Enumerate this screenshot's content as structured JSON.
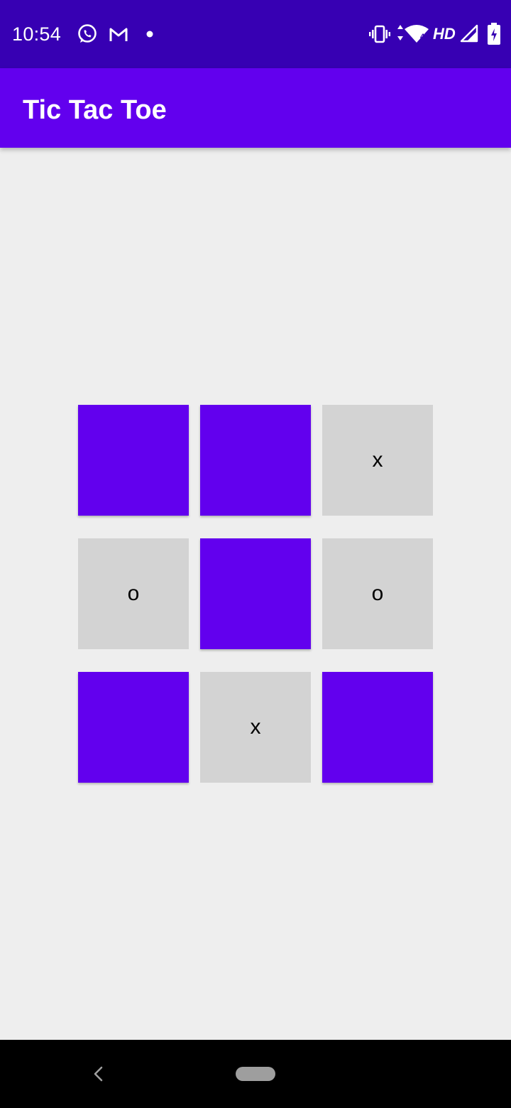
{
  "status_bar": {
    "time": "10:54",
    "icons": [
      "whatsapp-icon",
      "gmail-icon",
      "notification-dot-icon",
      "vibrate-icon",
      "wifi-icon",
      "signal-icon",
      "battery-charging-icon"
    ],
    "network_label": "HD"
  },
  "app_bar": {
    "title": "Tic Tac Toe"
  },
  "board": {
    "cells": [
      {
        "mark": ""
      },
      {
        "mark": ""
      },
      {
        "mark": "x"
      },
      {
        "mark": "o"
      },
      {
        "mark": ""
      },
      {
        "mark": "o"
      },
      {
        "mark": ""
      },
      {
        "mark": "x"
      },
      {
        "mark": ""
      }
    ]
  },
  "nav_bar": {
    "icons": [
      "back-icon",
      "home-pill-icon"
    ]
  },
  "colors": {
    "status_bar": "#3700b3",
    "app_bar": "#6200ee",
    "empty_cell": "#6200ee",
    "filled_cell": "#d3d3d3",
    "background": "#eeeeee",
    "nav_bar": "#000000"
  }
}
